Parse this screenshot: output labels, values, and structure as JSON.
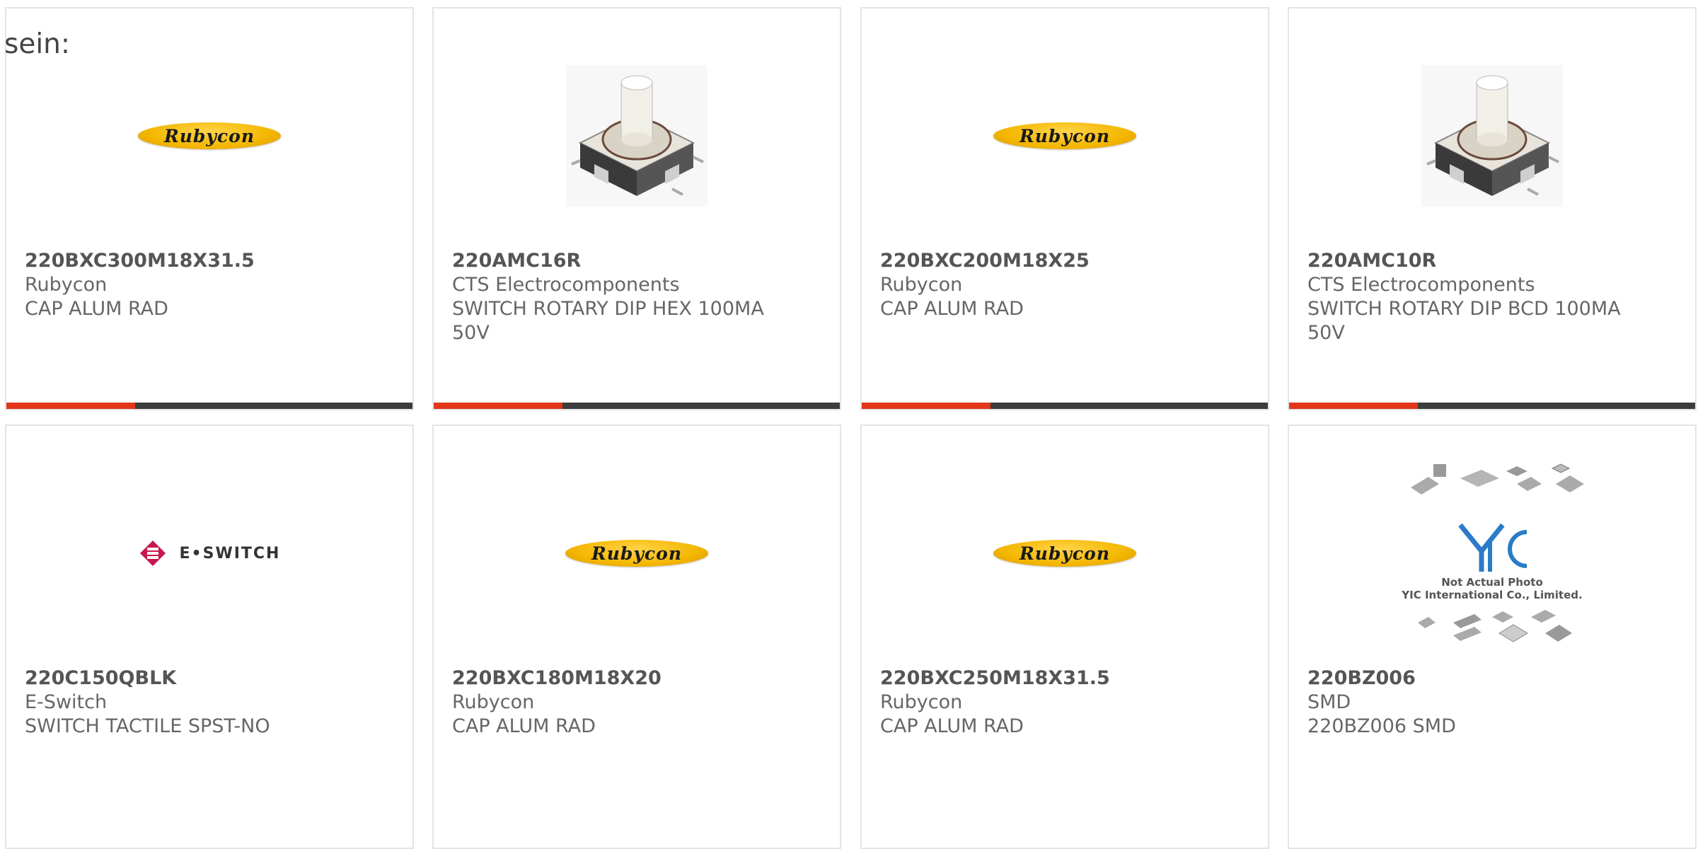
{
  "intro_text": "sein:",
  "colors": {
    "accent": "#e2361a",
    "bar": "#3d3d3d",
    "border": "#e4e4e4"
  },
  "products": [
    {
      "part_number": "220BXC300M18X31.5",
      "manufacturer": "Rubycon",
      "description": "CAP ALUM RAD",
      "image": "rubycon-logo",
      "logo_text": "Rubycon"
    },
    {
      "part_number": "220AMC16R",
      "manufacturer": "CTS Electrocomponents",
      "description": "SWITCH ROTARY DIP HEX 100MA 50V",
      "image": "rotary-dip-switch-photo"
    },
    {
      "part_number": "220BXC200M18X25",
      "manufacturer": "Rubycon",
      "description": "CAP ALUM RAD",
      "image": "rubycon-logo",
      "logo_text": "Rubycon"
    },
    {
      "part_number": "220AMC10R",
      "manufacturer": "CTS Electrocomponents",
      "description": "SWITCH ROTARY DIP BCD 100MA 50V",
      "image": "rotary-dip-switch-photo"
    },
    {
      "part_number": "220C150QBLK",
      "manufacturer": "E-Switch",
      "description": "SWITCH TACTILE SPST-NO",
      "image": "eswitch-logo",
      "logo_text": "E•SWITCH"
    },
    {
      "part_number": "220BXC180M18X20",
      "manufacturer": "Rubycon",
      "description": "CAP ALUM RAD",
      "image": "rubycon-logo",
      "logo_text": "Rubycon"
    },
    {
      "part_number": "220BXC250M18X31.5",
      "manufacturer": "Rubycon",
      "description": "CAP ALUM RAD",
      "image": "rubycon-logo",
      "logo_text": "Rubycon"
    },
    {
      "part_number": "220BZ006",
      "manufacturer": "SMD",
      "description": "220BZ006 SMD",
      "image": "not-actual-photo-placeholder",
      "logo_text": "YIC",
      "note_line1": "Not Actual Photo",
      "note_line2": "YIC International Co., Limited."
    }
  ]
}
